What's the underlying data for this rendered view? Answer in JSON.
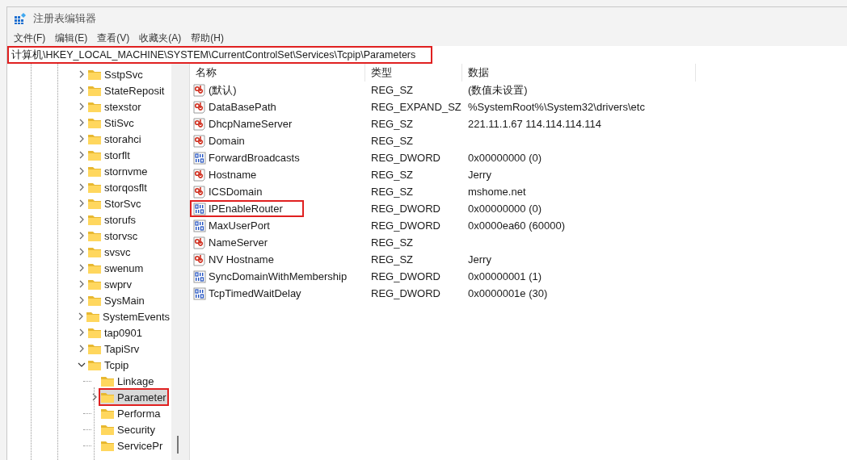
{
  "window": {
    "title": "注册表编辑器"
  },
  "menu": [
    "文件(F)",
    "编辑(E)",
    "查看(V)",
    "收藏夹(A)",
    "帮助(H)"
  ],
  "address_bar": {
    "value": "计算机\\HKEY_LOCAL_MACHINE\\SYSTEM\\CurrentControlSet\\Services\\Tcpip\\Parameters",
    "highlighted": true
  },
  "tree": {
    "items": [
      {
        "label": "SstpSvc",
        "expandable": true,
        "expanded": false,
        "selected": false,
        "highlighted": false
      },
      {
        "label": "StateReposit",
        "expandable": true,
        "expanded": false,
        "selected": false,
        "highlighted": false
      },
      {
        "label": "stexstor",
        "expandable": true,
        "expanded": false,
        "selected": false,
        "highlighted": false
      },
      {
        "label": "StiSvc",
        "expandable": true,
        "expanded": false,
        "selected": false,
        "highlighted": false
      },
      {
        "label": "storahci",
        "expandable": true,
        "expanded": false,
        "selected": false,
        "highlighted": false
      },
      {
        "label": "storflt",
        "expandable": true,
        "expanded": false,
        "selected": false,
        "highlighted": false
      },
      {
        "label": "stornvme",
        "expandable": true,
        "expanded": false,
        "selected": false,
        "highlighted": false
      },
      {
        "label": "storqosflt",
        "expandable": true,
        "expanded": false,
        "selected": false,
        "highlighted": false
      },
      {
        "label": "StorSvc",
        "expandable": true,
        "expanded": false,
        "selected": false,
        "highlighted": false
      },
      {
        "label": "storufs",
        "expandable": true,
        "expanded": false,
        "selected": false,
        "highlighted": false
      },
      {
        "label": "storvsc",
        "expandable": true,
        "expanded": false,
        "selected": false,
        "highlighted": false
      },
      {
        "label": "svsvc",
        "expandable": true,
        "expanded": false,
        "selected": false,
        "highlighted": false
      },
      {
        "label": "swenum",
        "expandable": true,
        "expanded": false,
        "selected": false,
        "highlighted": false
      },
      {
        "label": "swprv",
        "expandable": true,
        "expanded": false,
        "selected": false,
        "highlighted": false
      },
      {
        "label": "SysMain",
        "expandable": true,
        "expanded": false,
        "selected": false,
        "highlighted": false
      },
      {
        "label": "SystemEvents",
        "expandable": true,
        "expanded": false,
        "selected": false,
        "highlighted": false
      },
      {
        "label": "tap0901",
        "expandable": true,
        "expanded": false,
        "selected": false,
        "highlighted": false
      },
      {
        "label": "TapiSrv",
        "expandable": true,
        "expanded": false,
        "selected": false,
        "highlighted": false
      },
      {
        "label": "Tcpip",
        "expandable": true,
        "expanded": true,
        "selected": false,
        "highlighted": false,
        "children": [
          {
            "label": "Linkage",
            "expandable": false,
            "selected": false,
            "highlighted": false
          },
          {
            "label": "Parameter",
            "expandable": true,
            "expanded": false,
            "selected": true,
            "highlighted": true
          },
          {
            "label": "Performa",
            "expandable": false,
            "selected": false,
            "highlighted": false
          },
          {
            "label": "Security",
            "expandable": false,
            "selected": false,
            "highlighted": false
          },
          {
            "label": "ServicePr",
            "expandable": false,
            "selected": false,
            "highlighted": false
          }
        ]
      }
    ]
  },
  "values": {
    "columns": [
      "名称",
      "类型",
      "数据"
    ],
    "rows": [
      {
        "kind": "string",
        "name": "(默认)",
        "type": "REG_SZ",
        "data": "(数值未设置)",
        "highlighted": false
      },
      {
        "kind": "string",
        "name": "DataBasePath",
        "type": "REG_EXPAND_SZ",
        "data": "%SystemRoot%\\System32\\drivers\\etc",
        "highlighted": false
      },
      {
        "kind": "string",
        "name": "DhcpNameServer",
        "type": "REG_SZ",
        "data": "221.11.1.67 114.114.114.114",
        "highlighted": false
      },
      {
        "kind": "string",
        "name": "Domain",
        "type": "REG_SZ",
        "highlighted": false
      },
      {
        "kind": "binary",
        "name": "ForwardBroadcasts",
        "type": "REG_DWORD",
        "data": "0x00000000 (0)",
        "highlighted": false
      },
      {
        "kind": "string",
        "name": "Hostname",
        "type": "REG_SZ",
        "data": "Jerry",
        "highlighted": false
      },
      {
        "kind": "string",
        "name": "ICSDomain",
        "type": "REG_SZ",
        "data": "mshome.net",
        "highlighted": false
      },
      {
        "kind": "binary",
        "name": "IPEnableRouter",
        "type": "REG_DWORD",
        "data": "0x00000000 (0)",
        "highlighted": true
      },
      {
        "kind": "binary",
        "name": "MaxUserPort",
        "type": "REG_DWORD",
        "data": "0x0000ea60 (60000)",
        "highlighted": false
      },
      {
        "kind": "string",
        "name": "NameServer",
        "type": "REG_SZ",
        "highlighted": false
      },
      {
        "kind": "string",
        "name": "NV Hostname",
        "type": "REG_SZ",
        "data": "Jerry",
        "highlighted": false
      },
      {
        "kind": "binary",
        "name": "SyncDomainWithMembership",
        "type": "REG_DWORD",
        "data": "0x00000001 (1)",
        "highlighted": false
      },
      {
        "kind": "binary",
        "name": "TcpTimedWaitDelay",
        "type": "REG_DWORD",
        "data": "0x0000001e (30)",
        "highlighted": false
      }
    ]
  }
}
